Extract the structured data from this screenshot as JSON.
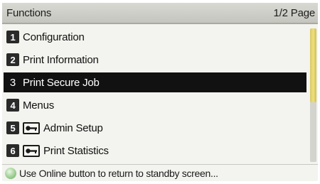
{
  "header": {
    "title": "Functions",
    "page_indicator": "1/2 Page"
  },
  "menu": {
    "items": [
      {
        "number": "1",
        "label": "Configuration",
        "icon": null,
        "selected": false
      },
      {
        "number": "2",
        "label": "Print Information",
        "icon": null,
        "selected": false
      },
      {
        "number": "3",
        "label": "Print Secure Job",
        "icon": null,
        "selected": true
      },
      {
        "number": "4",
        "label": "Menus",
        "icon": null,
        "selected": false
      },
      {
        "number": "5",
        "label": "Admin Setup",
        "icon": "key-icon",
        "selected": false
      },
      {
        "number": "6",
        "label": "Print Statistics",
        "icon": "key-icon",
        "selected": false
      }
    ]
  },
  "footer": {
    "icon": "online-led-icon",
    "text": "Use Online button to return to standby screen..."
  },
  "colors": {
    "selected_background": "#111111",
    "scrollbar_thumb": "#e6d66e",
    "online_led": "#9fcf94"
  }
}
